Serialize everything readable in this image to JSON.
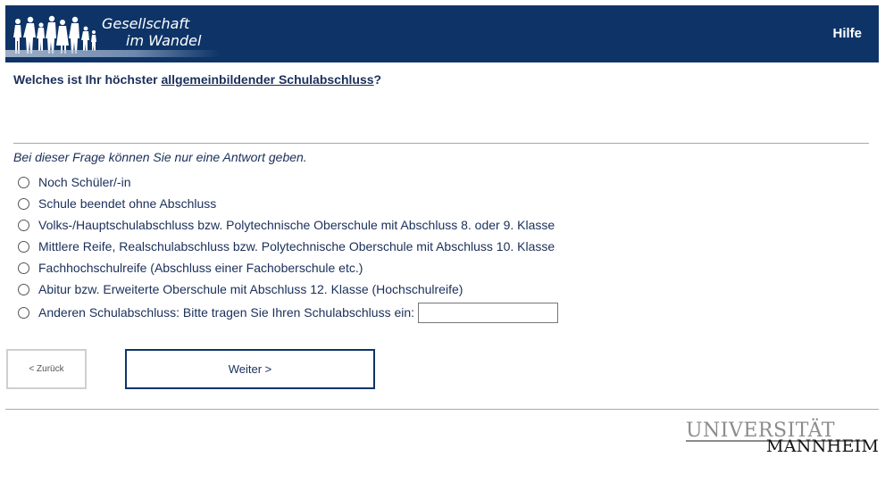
{
  "header": {
    "logo_line1": "Gesellschaft",
    "logo_line2": "im Wandel",
    "help_label": "Hilfe",
    "background_color": "#0e3467"
  },
  "question": {
    "prefix": "Welches ist Ihr höchster ",
    "term": "allgemeinbildender Schulabschluss",
    "suffix": "?"
  },
  "instruction": "Bei dieser Frage können Sie nur eine Antwort geben.",
  "options": [
    {
      "label": "Noch Schüler/-in",
      "selected": false
    },
    {
      "label": "Schule beendet ohne Abschluss",
      "selected": false
    },
    {
      "label": "Volks-/Hauptschulabschluss bzw. Polytechnische Oberschule mit Abschluss 8. oder 9. Klasse",
      "selected": false
    },
    {
      "label": "Mittlere Reife, Realschulabschluss bzw. Polytechnische Oberschule mit Abschluss 10. Klasse",
      "selected": false
    },
    {
      "label": "Fachhochschulreife (Abschluss einer Fachoberschule etc.)",
      "selected": false
    },
    {
      "label": "Abitur bzw. Erweiterte Oberschule mit Abschluss 12. Klasse (Hochschulreife)",
      "selected": false
    },
    {
      "label": "Anderen Schulabschluss: Bitte tragen Sie Ihren Schulabschluss ein:",
      "selected": false,
      "text_value": ""
    }
  ],
  "navigation": {
    "back_label": "< Zurück",
    "next_label": "Weiter >"
  },
  "footer": {
    "university_line1": "UNIVERSITÄT",
    "university_line2": "MANNHEIM"
  }
}
